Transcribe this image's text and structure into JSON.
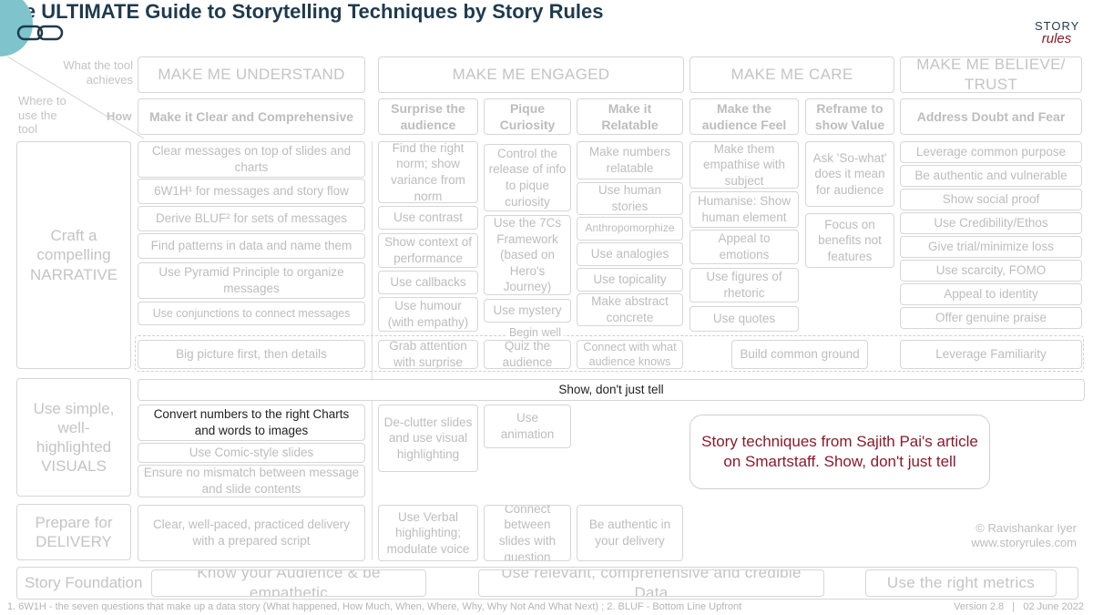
{
  "header": {
    "title": "The ULTIMATE Guide to Storytelling Techniques by Story Rules",
    "logo_line1": "STORY",
    "logo_line2": "rules"
  },
  "corner": {
    "what": "What the tool achieves",
    "where": "Where to use the tool",
    "how": "How"
  },
  "columns": {
    "understand": "MAKE ME UNDERSTAND",
    "engaged": "MAKE ME ENGAGED",
    "care": "MAKE ME CARE",
    "believe": "MAKE ME BELIEVE/ TRUST"
  },
  "subheads": {
    "clear": "Make it Clear and Comprehensive",
    "surprise": "Surprise the audience",
    "pique": "Pique Curiosity",
    "relatable": "Make it Relatable",
    "feel": "Make the audience Feel",
    "reframe": "Reframe to show Value",
    "doubt": "Address Doubt and Fear"
  },
  "rows": {
    "narrative": "Craft a compelling NARRATIVE",
    "visuals": "Use simple, well-highlighted VISUALS",
    "delivery": "Prepare for DELIVERY",
    "foundation": "Story Foundation"
  },
  "cells": {
    "clear_messages": "Clear messages on top of slides and charts",
    "sixw": "6W1H¹ for messages and story flow",
    "bluf": "Derive BLUF² for sets of messages",
    "patterns": "Find patterns in data and name them",
    "pyramid": "Use Pyramid Principle to organize messages",
    "conjunctions": "Use conjunctions to connect messages",
    "norm": "Find the right norm; show variance from norm",
    "contrast": "Use contrast",
    "context": "Show context of performance",
    "callbacks": "Use callbacks",
    "humour": "Use humour (with empathy)",
    "control": "Control the release of info to pique curiosity",
    "sevencs": "Use the 7Cs Framework (based on Hero's Journey)",
    "mystery": "Use mystery",
    "numbers_relatable": "Make numbers relatable",
    "human_stories": "Use human stories",
    "anthropo": "Anthropomorphize",
    "analogies": "Use analogies",
    "topicality": "Use topicality",
    "abstract": "Make abstract concrete",
    "empathise": "Make them empathise with subject",
    "humanise": "Humanise: Show human element",
    "appeal_emotions": "Appeal to emotions",
    "figures": "Use figures of rhetoric",
    "quotes": "Use quotes",
    "sowhat": "Ask 'So-what' does it mean for audience",
    "benefits": "Focus on benefits not features",
    "purpose": "Leverage common purpose",
    "authentic": "Be authentic and vulnerable",
    "social": "Show social proof",
    "credibility": "Use Credibility/Ethos",
    "trial": "Give trial/minimize loss",
    "scarcity": "Use scarcity, FOMO",
    "identity": "Appeal to identity",
    "praise": "Offer genuine praise",
    "bigpicture": "Big picture first, then details",
    "grab": "Grab attention with surprise",
    "begin_well": "Begin well",
    "quiz": "Quiz the audience",
    "connect_knows": "Connect with what audience knows",
    "common_ground": "Build common ground",
    "familiarity": "Leverage Familiarity",
    "show_tell": "Show, don't just tell",
    "convert": "Convert numbers to the right Charts and words to images",
    "comic": "Use Comic-style slides",
    "mismatch": "Ensure no mismatch between message and slide contents",
    "declutter": "De-clutter slides and use visual highlighting",
    "animation": "Use animation",
    "wellpaced": "Clear, well-paced, practiced delivery with a prepared script",
    "verbal": "Use Verbal highlighting; modulate voice",
    "connect_slides": "Connect between slides with question",
    "authentic_delivery": "Be authentic in your delivery",
    "know_audience": "Know your Audience & be empathetic",
    "data": "Use relevant, comprehensive and credible Data",
    "metrics": "Use the right metrics"
  },
  "callout": "Story techniques from Sajith Pai's article on Smartstaff. Show, don't just tell",
  "credit": {
    "author": "© Ravishankar Iyer",
    "site": "www.storyrules.com"
  },
  "footer": {
    "footnote": "1. 6W1H - the seven questions that make up a data story (What happened, How Much, When, Where, Why, Why Not And What Next) ; 2. BLUF - Bottom Line Upfront",
    "version": "Version 2.8   |   02 June 2022"
  },
  "colors": {
    "title": "#1f3a4d",
    "logo_accent": "#8b1a2b",
    "callout_text": "#8b1a2b",
    "corner_circle": "#7fc4cc",
    "muted_text": "#bdbdbd"
  },
  "icons": [
    "link-chain-icon"
  ]
}
